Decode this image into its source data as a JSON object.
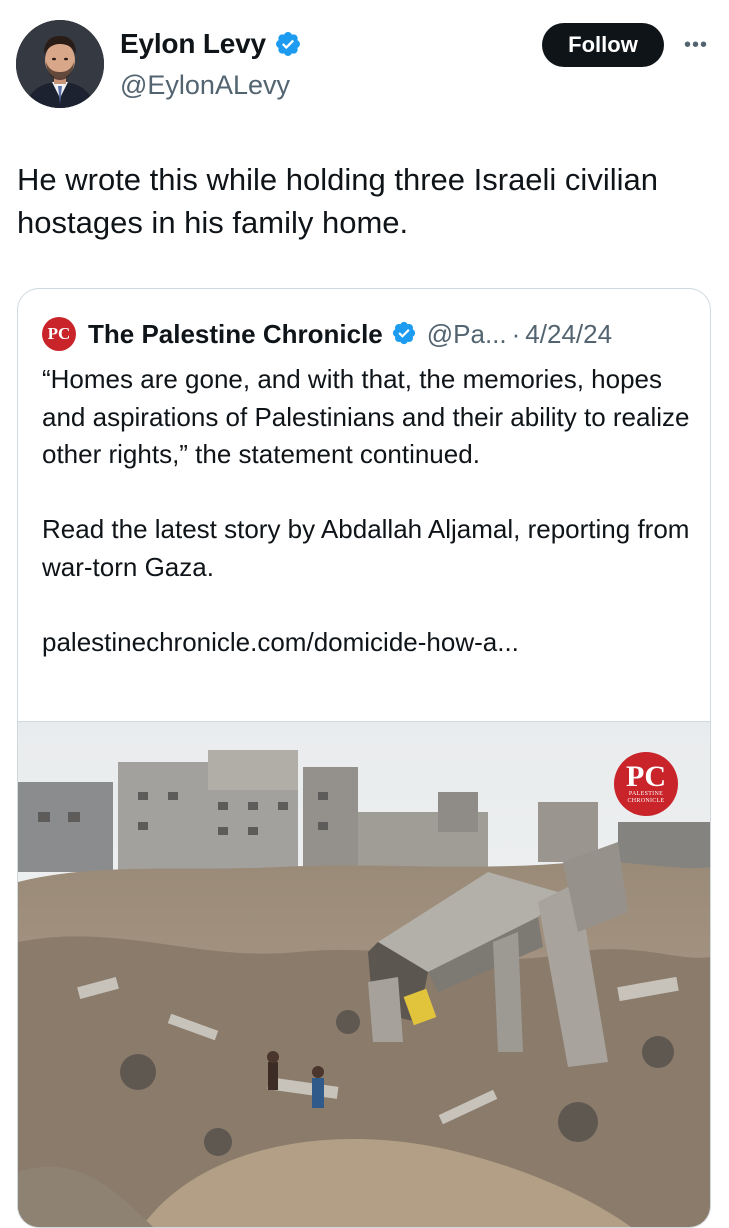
{
  "author": {
    "display_name": "Eylon Levy",
    "handle": "@EylonALevy",
    "verified_icon": "verified-badge-icon",
    "avatar_icon": "profile-photo"
  },
  "actions": {
    "follow_label": "Follow",
    "more_label": "•••"
  },
  "tweet": {
    "text": "He wrote this while holding three Israeli civilian hostages in his family home."
  },
  "quoted": {
    "logo_text": "PC",
    "name": "The Palestine Chronicle",
    "handle": "@Pa...",
    "separator": "·",
    "date": "4/24/24",
    "paragraph_1": "“Homes are gone, and with that, the memories, hopes and aspirations of Palestinians and their ability to realize other rights,” the statement continued.",
    "paragraph_2": "Read the latest story by Abdallah Aljamal, reporting from war-torn Gaza.",
    "link": "palestinechronicle.com/domicide-how-a...",
    "image": {
      "logo_main": "PC",
      "logo_sub": "PALESTINE CHRONICLE",
      "subject": "rubble-photo"
    }
  },
  "colors": {
    "text_primary": "#0f1419",
    "text_secondary": "#536471",
    "verified_blue": "#1d9bf0",
    "border": "#cfd9de",
    "brand_red": "#c8242a",
    "follow_bg": "#0f1419"
  }
}
